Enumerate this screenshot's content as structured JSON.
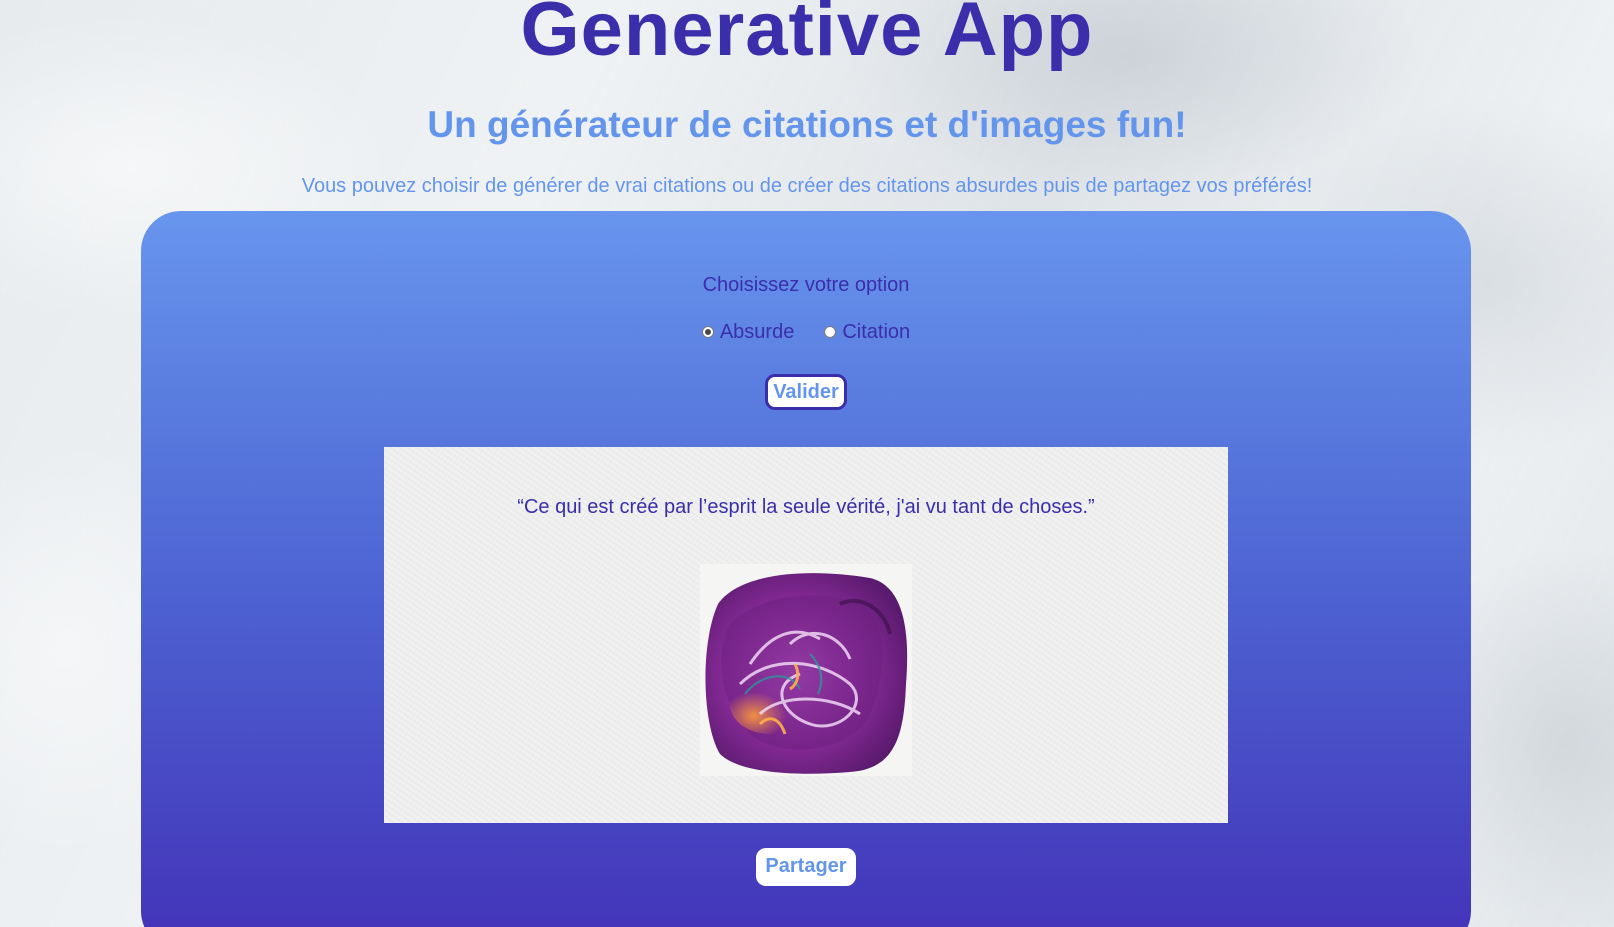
{
  "header": {
    "title": "Generative App",
    "subtitle": "Un générateur de citations et d'images fun!",
    "description": "Vous pouvez choisir de générer de vrai citations ou de créer des citations absurdes puis de partagez vos préférés!"
  },
  "form": {
    "prompt_label": "Choisissez votre option",
    "options": [
      {
        "label": "Absurde",
        "checked": true
      },
      {
        "label": "Citation",
        "checked": false
      }
    ],
    "submit_label": "Valider"
  },
  "result": {
    "quote": "“Ce qui est créé par l’esprit la seule vérité, j'ai vu tant de choses.”",
    "image_icon": "abstract-purple-painting"
  },
  "share_label": "Partager",
  "colors": {
    "title": "#3a2eab",
    "accent": "#6495ed",
    "panel_top": "#6895ee",
    "panel_bottom": "#4332b8"
  }
}
